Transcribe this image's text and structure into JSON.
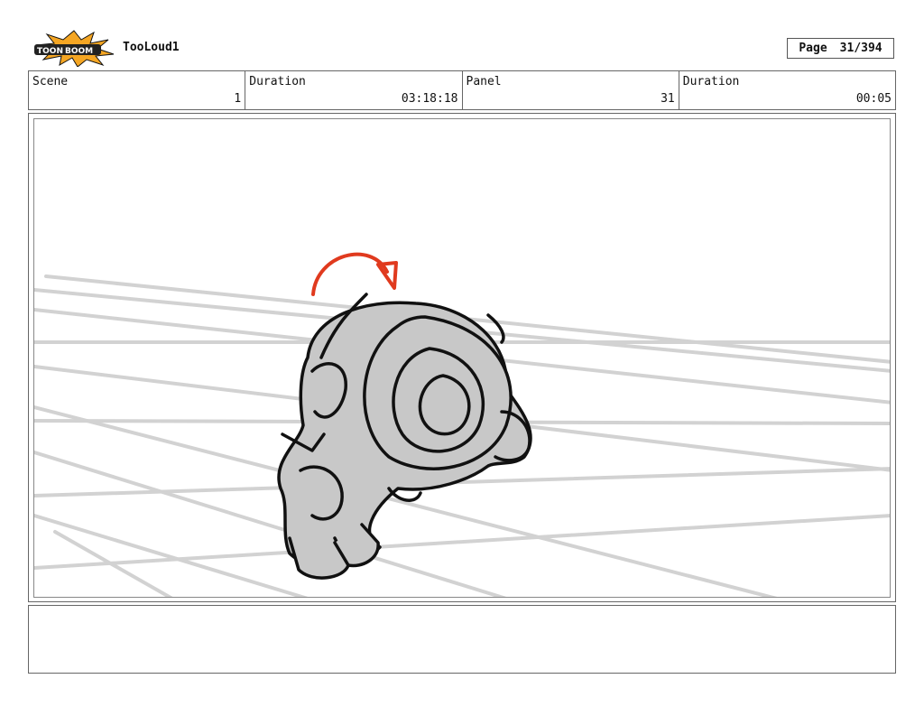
{
  "header": {
    "project_title": "TooLoud1",
    "page_label": "Page",
    "page_value": "31/394",
    "logo_icon": "toonboom-logo"
  },
  "info": {
    "scene_label": "Scene",
    "scene_value": "1",
    "duration_label": "Duration",
    "duration_value": "03:18:18",
    "panel_label": "Panel",
    "panel_value": "31",
    "panel_duration_label": "Duration",
    "panel_duration_value": "00:05"
  },
  "panel": {
    "sketch_icon": "character-rolling-sketch",
    "arrow_icon": "motion-arrow-icon",
    "arrow_color": "#e03a1e",
    "fill_color": "#c8c8c8",
    "grid_color": "#d2d2d2"
  },
  "notes": {
    "text": ""
  }
}
